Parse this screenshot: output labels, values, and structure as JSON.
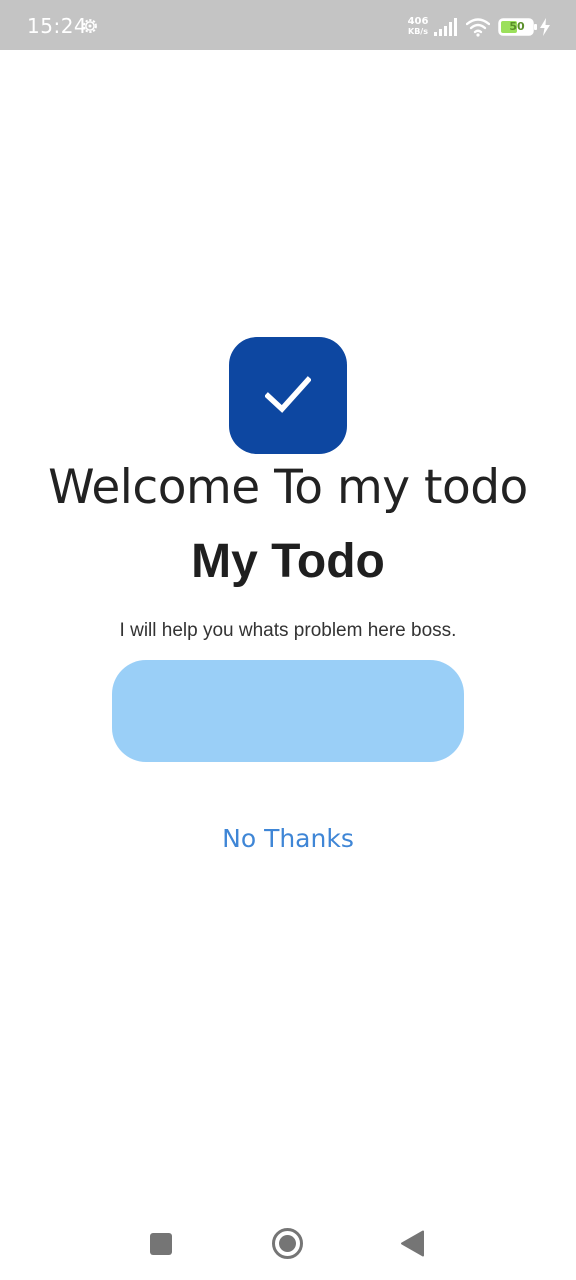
{
  "status_bar": {
    "time": "15:24",
    "settings_icon": "gear-icon",
    "net_speed_value": "406",
    "net_speed_unit": "KB/s",
    "signal_icon": "cellular-signal-icon",
    "wifi_icon": "wifi-icon",
    "battery_level": "50",
    "battery_icon": "battery-icon",
    "charging_icon": "charging-bolt-icon"
  },
  "main": {
    "logo_icon": "checkmark-icon",
    "welcome_title": "Welcome To my todo",
    "app_name": "My Todo",
    "subtitle": "I will help you whats problem here boss.",
    "primary_button_label": "",
    "secondary_button_label": "No Thanks"
  },
  "nav_bar": {
    "recents_icon": "square-recents-icon",
    "home_icon": "circle-home-icon",
    "back_icon": "triangle-back-icon"
  },
  "colors": {
    "status_bar_bg": "#c4c4c4",
    "logo_bg": "#0d47a1",
    "primary_button_bg": "#9acff7",
    "link_text": "#3f86d6",
    "nav_icon": "#757575"
  }
}
